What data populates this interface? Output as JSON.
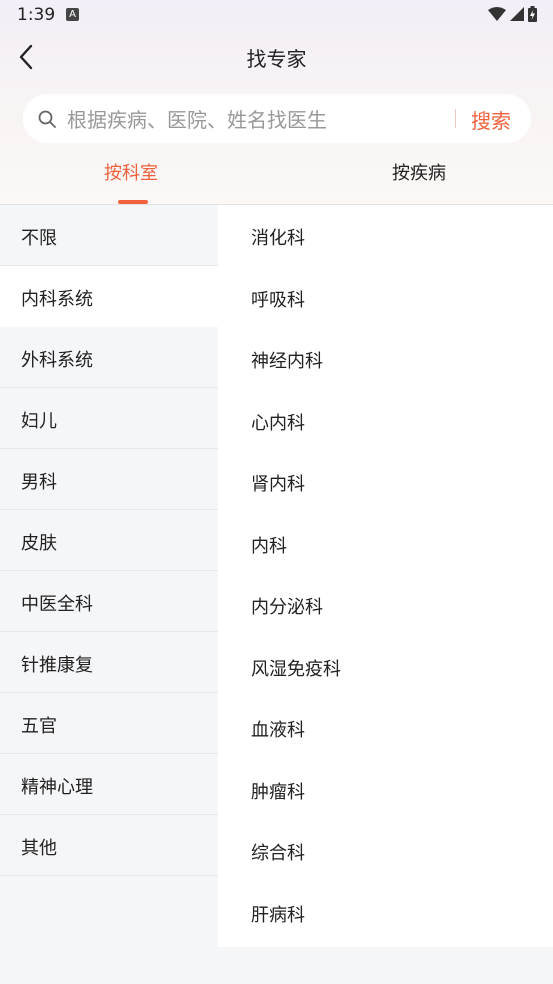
{
  "status_bar": {
    "time": "1:39",
    "notification_icon": "A"
  },
  "header": {
    "title": "找专家",
    "back_icon": "chevron-left-icon"
  },
  "search": {
    "placeholder": "根据疾病、医院、姓名找医生",
    "button_label": "搜索"
  },
  "tabs": [
    {
      "label": "按科室",
      "active": true
    },
    {
      "label": "按疾病",
      "active": false
    }
  ],
  "categories": [
    {
      "label": "不限"
    },
    {
      "label": "内科系统",
      "selected": true
    },
    {
      "label": "外科系统"
    },
    {
      "label": "妇儿"
    },
    {
      "label": "男科"
    },
    {
      "label": "皮肤"
    },
    {
      "label": "中医全科"
    },
    {
      "label": "针推康复"
    },
    {
      "label": "五官"
    },
    {
      "label": "精神心理"
    },
    {
      "label": "其他"
    }
  ],
  "departments": [
    {
      "label": "消化科"
    },
    {
      "label": "呼吸科"
    },
    {
      "label": "神经内科"
    },
    {
      "label": "心内科"
    },
    {
      "label": "肾内科"
    },
    {
      "label": "内科"
    },
    {
      "label": "内分泌科"
    },
    {
      "label": "风湿免疫科"
    },
    {
      "label": "血液科"
    },
    {
      "label": "肿瘤科"
    },
    {
      "label": "综合科"
    },
    {
      "label": "肝病科"
    }
  ],
  "colors": {
    "accent": "#f0613d",
    "text": "#222222",
    "sidebar_bg": "#f5f6f8"
  }
}
